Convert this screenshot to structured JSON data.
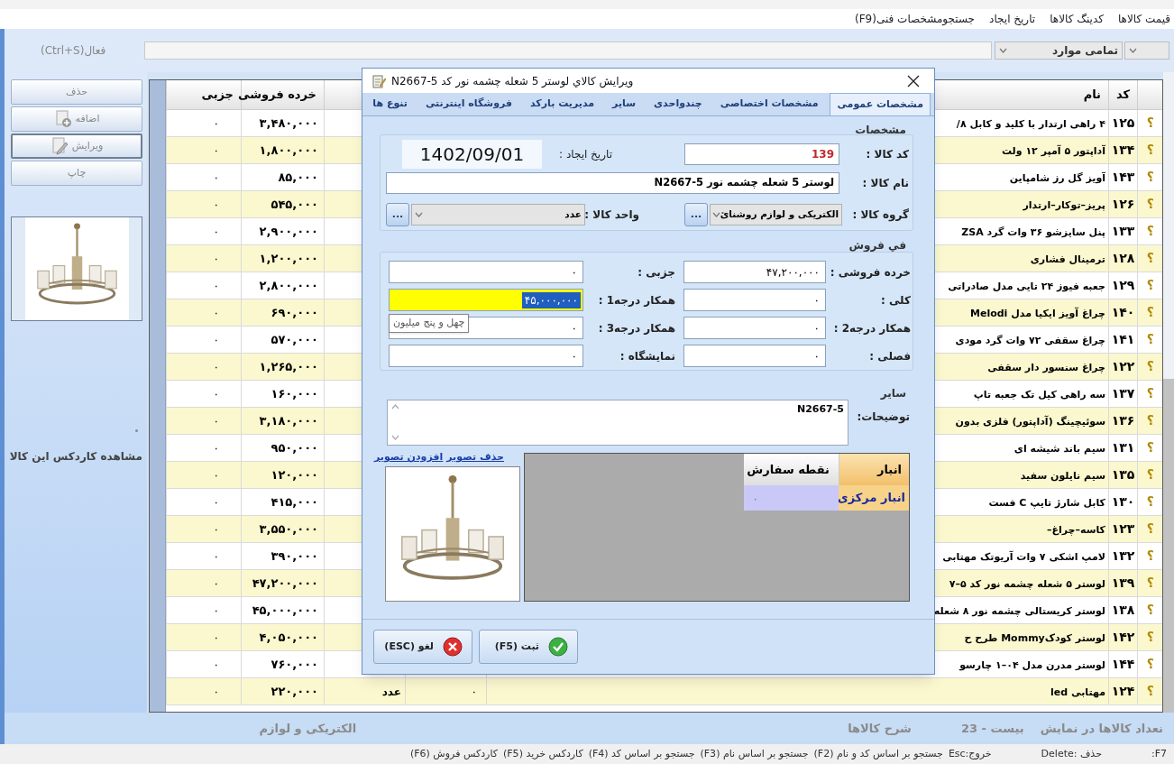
{
  "menu": [
    "قیمت کالاها",
    "کدینگ کالاها",
    "تاریخ ایجاد",
    "جستجومشخصات فنی(F9)"
  ],
  "toolbar": {
    "active_label": "فعال(Ctrl+S)",
    "filter": "تمامی موارد"
  },
  "side_buttons": [
    {
      "label": "حذف",
      "kind": "plain",
      "pressed": false
    },
    {
      "label": "اضافه",
      "kind": "add",
      "pressed": false
    },
    {
      "label": "ویرایش",
      "kind": "edit",
      "pressed": true
    },
    {
      "label": "چاپ",
      "kind": "plain",
      "pressed": false
    }
  ],
  "cardex_link": "مشاهده کاردکس این کالا",
  "table": {
    "columns": {
      "code": "کد",
      "name": "نام",
      "retail": "خرده فروشی",
      "partial": "جزبی"
    },
    "rows": [
      {
        "marker": "؟",
        "code": "۱۲۵",
        "name": "۴ راهی ارتدار با کلید و کابل ۸/",
        "retail": "۳,۴۸۰,۰۰۰",
        "partial": "۰"
      },
      {
        "marker": "؟",
        "code": "۱۳۴",
        "name": "آداپتور ۵ آمپر ۱۲ ولت",
        "retail": "۱,۸۰۰,۰۰۰",
        "partial": "۰"
      },
      {
        "marker": "؟",
        "code": "۱۴۳",
        "name": "آویز گل رز شامپاین",
        "retail": "۸۵,۰۰۰",
        "partial": "۰"
      },
      {
        "marker": "؟",
        "code": "۱۲۶",
        "name": "پریز–توکار–ارتدار",
        "retail": "۵۴۵,۰۰۰",
        "partial": "۰"
      },
      {
        "marker": "؟",
        "code": "۱۳۳",
        "name": "پنل سایزشو ۳۶ وات گرد ZSA",
        "retail": "۲,۹۰۰,۰۰۰",
        "partial": "۰"
      },
      {
        "marker": "؟",
        "code": "۱۲۸",
        "name": "ترمینال فشاری",
        "retail": "۱,۲۰۰,۰۰۰",
        "partial": "۰"
      },
      {
        "marker": "؟",
        "code": "۱۲۹",
        "name": "جعبه فیوز ۲۴ تایی مدل صادراتی",
        "retail": "۲,۸۰۰,۰۰۰",
        "partial": "۰"
      },
      {
        "marker": "؟",
        "code": "۱۴۰",
        "name": "چراغ آویز ایکیا مدل Melodi",
        "retail": "۶۹۰,۰۰۰",
        "partial": "۰"
      },
      {
        "marker": "؟",
        "code": "۱۴۱",
        "name": "چراغ سقفی ۷۲ وات گرد مودی",
        "retail": "۵۷۰,۰۰۰",
        "partial": "۰"
      },
      {
        "marker": "؟",
        "code": "۱۲۲",
        "name": "چراغ سنسور دار سقفی",
        "retail": "۱,۲۶۵,۰۰۰",
        "partial": "۰"
      },
      {
        "marker": "؟",
        "code": "۱۳۷",
        "name": "سه راهی کیل تک جعبه تاپ",
        "retail": "۱۶۰,۰۰۰",
        "partial": "۰"
      },
      {
        "marker": "؟",
        "code": "۱۳۶",
        "name": "سوئیچینگ (آداپتور) فلزی بدون",
        "retail": "۳,۱۸۰,۰۰۰",
        "partial": "۰"
      },
      {
        "marker": "؟",
        "code": "۱۳۱",
        "name": "سیم باند شیشه ای",
        "retail": "۹۵۰,۰۰۰",
        "partial": "۰"
      },
      {
        "marker": "؟",
        "code": "۱۳۵",
        "name": "سیم نایلون سفید",
        "retail": "۱۲۰,۰۰۰",
        "partial": "۰"
      },
      {
        "marker": "؟",
        "code": "۱۳۰",
        "name": "کابل شارژ تایپ C فست",
        "retail": "۴۱۵,۰۰۰",
        "partial": "۰"
      },
      {
        "marker": "؟",
        "code": "۱۲۳",
        "name": "کاسه–چراغ–",
        "retail": "۳,۵۵۰,۰۰۰",
        "partial": "۰"
      },
      {
        "marker": "؟",
        "code": "۱۳۲",
        "name": "لامپ اشکی ۷ وات آریوتک مهتابی",
        "retail": "۳۹۰,۰۰۰",
        "partial": "۰"
      },
      {
        "marker": "؟",
        "code": "۱۳۹",
        "name": "لوستر ۵ شعله چشمه نور کد ۵–۷",
        "retail": "۴۷,۲۰۰,۰۰۰",
        "partial": "۰"
      },
      {
        "marker": "؟",
        "code": "۱۳۸",
        "name": "لوستر کریستالی چشمه نور ۸ شعله",
        "retail": "۴۵,۰۰۰,۰۰۰",
        "partial": "۰"
      },
      {
        "marker": "؟",
        "code": "۱۴۲",
        "name": "لوستر کودکMommy طرح ح",
        "retail": "۴,۰۵۰,۰۰۰",
        "partial": "۰"
      },
      {
        "marker": "؟",
        "code": "۱۴۴",
        "name": "لوستر مدرن مدل ۰۴–۱ چارسو",
        "retail": "۷۶۰,۰۰۰",
        "partial": "۰"
      },
      {
        "marker": "؟",
        "code": "۱۲۴",
        "name": "مهتابی led",
        "column_5": "۰",
        "column_6": "عدد",
        "retail": "۲۲۰,۰۰۰",
        "partial": "۰"
      }
    ]
  },
  "footer": {
    "count_label": "نعداد کالاها در نمایش",
    "count": "بیست - 23",
    "description_label": "شرح کالاها",
    "group": "الکتریکی و لوازم"
  },
  "status_bar": [
    "F7:",
    "حذف :Delete",
    "خروج:Esc",
    "جستجو بر اساس کد و نام (F2)",
    "جستجو بر اساس نام (F3)",
    "جستجو بر اساس کد (F4)",
    "کاردکس خرید (F5)",
    "کاردکس فروش (F6)"
  ],
  "dialog": {
    "title": "ویرایش کالاي لوستر 5 شعله چشمه نور کد N2667-5",
    "tabs": [
      {
        "label": "مشخصات عمومی",
        "selected": true
      },
      {
        "label": "مشخصات اختصاصی",
        "selected": false
      },
      {
        "label": "چندواحدی",
        "selected": false
      },
      {
        "label": "سایر",
        "selected": false
      },
      {
        "label": "مدیریت بارکد",
        "selected": false
      },
      {
        "label": "فروشگاه اینترنتی",
        "selected": false
      },
      {
        "label": "تنوع ها",
        "selected": false
      }
    ],
    "general": {
      "heading": "مشخصات",
      "code_label": "کد کالا :",
      "code": "139",
      "created_label": "تاریخ ایجاد :",
      "created": "1402/09/01",
      "name_label": "نام کالا :",
      "name": "لوستر 5 شعله چشمه نور N2667-5",
      "group_label": "گروه کالا :",
      "group": "الکتریکی و لوازم روشنائ",
      "group_browse": "...",
      "unit_label": "واحد کالا :",
      "unit": "عدد",
      "unit_browse": "..."
    },
    "prices": {
      "heading": "في فروش",
      "fields": [
        {
          "label": "خرده فروشی :",
          "value": "۴۷,۲۰۰,۰۰۰",
          "focused": false
        },
        {
          "label": "جزبی :",
          "value": "۰",
          "focused": false
        },
        {
          "label": "کلی :",
          "value": "۰",
          "focused": false
        },
        {
          "label": "همکار درجه1 :",
          "value": "۴۵,۰۰۰,۰۰۰",
          "focused": true
        },
        {
          "label": "همکار درجه2 :",
          "value": "۰",
          "focused": false
        },
        {
          "label": "همکار درجه3 :",
          "value": "۰",
          "focused": false
        },
        {
          "label": "فصلی :",
          "value": "۰",
          "focused": false
        },
        {
          "label": "نمایشگاه :",
          "value": "۰",
          "focused": false
        }
      ]
    },
    "tooltip": "چهل و پنج میلیون",
    "other": {
      "heading": "سایر",
      "notes_label": "توضیحات:",
      "notes": "N2667-5"
    },
    "image_links": [
      "حذف تصویر",
      "افزودن تصویر"
    ],
    "stock": {
      "columns": [
        "انبار",
        "نقطه سفارش"
      ],
      "rows": [
        {
          "warehouse": "انبار مرکزی",
          "reorder_point": "۰"
        }
      ]
    },
    "buttons": [
      {
        "label": "ثبت (F5)",
        "kind": "ok"
      },
      {
        "label": "لغو (ESC)",
        "kind": "cancel"
      }
    ]
  }
}
